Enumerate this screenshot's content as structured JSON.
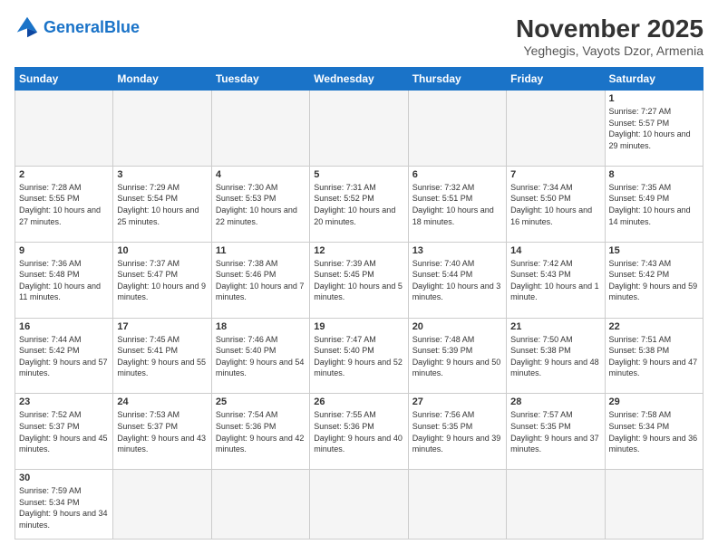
{
  "header": {
    "logo_general": "General",
    "logo_blue": "Blue",
    "month_title": "November 2025",
    "location": "Yeghegis, Vayots Dzor, Armenia"
  },
  "days_of_week": [
    "Sunday",
    "Monday",
    "Tuesday",
    "Wednesday",
    "Thursday",
    "Friday",
    "Saturday"
  ],
  "weeks": [
    [
      {
        "day": "",
        "info": ""
      },
      {
        "day": "",
        "info": ""
      },
      {
        "day": "",
        "info": ""
      },
      {
        "day": "",
        "info": ""
      },
      {
        "day": "",
        "info": ""
      },
      {
        "day": "",
        "info": ""
      },
      {
        "day": "1",
        "info": "Sunrise: 7:27 AM\nSunset: 5:57 PM\nDaylight: 10 hours and 29 minutes."
      }
    ],
    [
      {
        "day": "2",
        "info": "Sunrise: 7:28 AM\nSunset: 5:55 PM\nDaylight: 10 hours and 27 minutes."
      },
      {
        "day": "3",
        "info": "Sunrise: 7:29 AM\nSunset: 5:54 PM\nDaylight: 10 hours and 25 minutes."
      },
      {
        "day": "4",
        "info": "Sunrise: 7:30 AM\nSunset: 5:53 PM\nDaylight: 10 hours and 22 minutes."
      },
      {
        "day": "5",
        "info": "Sunrise: 7:31 AM\nSunset: 5:52 PM\nDaylight: 10 hours and 20 minutes."
      },
      {
        "day": "6",
        "info": "Sunrise: 7:32 AM\nSunset: 5:51 PM\nDaylight: 10 hours and 18 minutes."
      },
      {
        "day": "7",
        "info": "Sunrise: 7:34 AM\nSunset: 5:50 PM\nDaylight: 10 hours and 16 minutes."
      },
      {
        "day": "8",
        "info": "Sunrise: 7:35 AM\nSunset: 5:49 PM\nDaylight: 10 hours and 14 minutes."
      }
    ],
    [
      {
        "day": "9",
        "info": "Sunrise: 7:36 AM\nSunset: 5:48 PM\nDaylight: 10 hours and 11 minutes."
      },
      {
        "day": "10",
        "info": "Sunrise: 7:37 AM\nSunset: 5:47 PM\nDaylight: 10 hours and 9 minutes."
      },
      {
        "day": "11",
        "info": "Sunrise: 7:38 AM\nSunset: 5:46 PM\nDaylight: 10 hours and 7 minutes."
      },
      {
        "day": "12",
        "info": "Sunrise: 7:39 AM\nSunset: 5:45 PM\nDaylight: 10 hours and 5 minutes."
      },
      {
        "day": "13",
        "info": "Sunrise: 7:40 AM\nSunset: 5:44 PM\nDaylight: 10 hours and 3 minutes."
      },
      {
        "day": "14",
        "info": "Sunrise: 7:42 AM\nSunset: 5:43 PM\nDaylight: 10 hours and 1 minute."
      },
      {
        "day": "15",
        "info": "Sunrise: 7:43 AM\nSunset: 5:42 PM\nDaylight: 9 hours and 59 minutes."
      }
    ],
    [
      {
        "day": "16",
        "info": "Sunrise: 7:44 AM\nSunset: 5:42 PM\nDaylight: 9 hours and 57 minutes."
      },
      {
        "day": "17",
        "info": "Sunrise: 7:45 AM\nSunset: 5:41 PM\nDaylight: 9 hours and 55 minutes."
      },
      {
        "day": "18",
        "info": "Sunrise: 7:46 AM\nSunset: 5:40 PM\nDaylight: 9 hours and 54 minutes."
      },
      {
        "day": "19",
        "info": "Sunrise: 7:47 AM\nSunset: 5:40 PM\nDaylight: 9 hours and 52 minutes."
      },
      {
        "day": "20",
        "info": "Sunrise: 7:48 AM\nSunset: 5:39 PM\nDaylight: 9 hours and 50 minutes."
      },
      {
        "day": "21",
        "info": "Sunrise: 7:50 AM\nSunset: 5:38 PM\nDaylight: 9 hours and 48 minutes."
      },
      {
        "day": "22",
        "info": "Sunrise: 7:51 AM\nSunset: 5:38 PM\nDaylight: 9 hours and 47 minutes."
      }
    ],
    [
      {
        "day": "23",
        "info": "Sunrise: 7:52 AM\nSunset: 5:37 PM\nDaylight: 9 hours and 45 minutes."
      },
      {
        "day": "24",
        "info": "Sunrise: 7:53 AM\nSunset: 5:37 PM\nDaylight: 9 hours and 43 minutes."
      },
      {
        "day": "25",
        "info": "Sunrise: 7:54 AM\nSunset: 5:36 PM\nDaylight: 9 hours and 42 minutes."
      },
      {
        "day": "26",
        "info": "Sunrise: 7:55 AM\nSunset: 5:36 PM\nDaylight: 9 hours and 40 minutes."
      },
      {
        "day": "27",
        "info": "Sunrise: 7:56 AM\nSunset: 5:35 PM\nDaylight: 9 hours and 39 minutes."
      },
      {
        "day": "28",
        "info": "Sunrise: 7:57 AM\nSunset: 5:35 PM\nDaylight: 9 hours and 37 minutes."
      },
      {
        "day": "29",
        "info": "Sunrise: 7:58 AM\nSunset: 5:34 PM\nDaylight: 9 hours and 36 minutes."
      }
    ],
    [
      {
        "day": "30",
        "info": "Sunrise: 7:59 AM\nSunset: 5:34 PM\nDaylight: 9 hours and 34 minutes."
      },
      {
        "day": "",
        "info": ""
      },
      {
        "day": "",
        "info": ""
      },
      {
        "day": "",
        "info": ""
      },
      {
        "day": "",
        "info": ""
      },
      {
        "day": "",
        "info": ""
      },
      {
        "day": "",
        "info": ""
      }
    ]
  ]
}
